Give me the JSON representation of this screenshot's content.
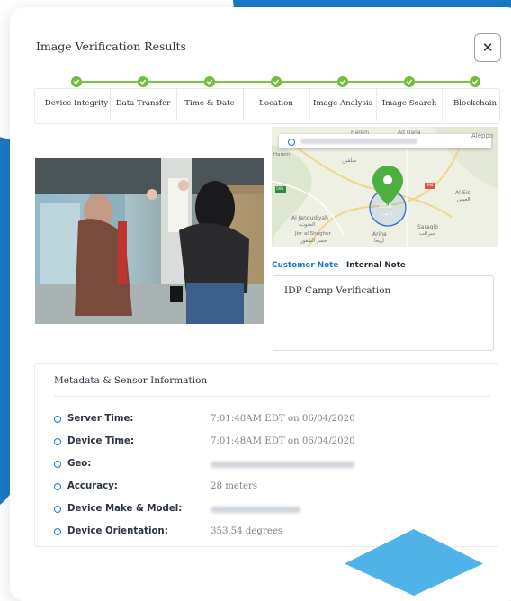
{
  "dialog": {
    "title": "Image Verification Results",
    "close_icon": "close-icon"
  },
  "steps": [
    {
      "label": "Device Integrity",
      "status": "complete"
    },
    {
      "label": "Data Transfer",
      "status": "complete"
    },
    {
      "label": "Time & Date",
      "status": "complete"
    },
    {
      "label": "Location",
      "status": "complete"
    },
    {
      "label": "Image Analysis",
      "status": "complete"
    },
    {
      "label": "Image Search",
      "status": "complete"
    },
    {
      "label": "Blockchain",
      "status": "complete"
    }
  ],
  "map": {
    "labels": {
      "harem": "Harem",
      "ad_dana": "Ad Dana",
      "aleppo": "Aleppo",
      "harem_ar": "حارم",
      "salqin": "سلقين",
      "jisr": "Jisr al Shughur",
      "jisr_ar": "جسر الشغور",
      "al_janoudiyah": "Al Janoudiyah",
      "al_janoudiyah_ar": "الجنودية",
      "idlib": "Idlib",
      "idlib_ar": "إدلب",
      "ariha": "Ariha",
      "ariha_ar": "أريحا",
      "saraqib": "Saraqib",
      "saraqib_ar": "سراقب",
      "al_eis": "Al-Eis",
      "al_eis_ar": "العيس",
      "road_591": "591",
      "road_m4": "M4",
      "hayaye": "Harem"
    }
  },
  "notes": {
    "tabs": [
      "Customer Note",
      "Internal Note"
    ],
    "active_tab": "Customer Note",
    "value": "IDP Camp Verification"
  },
  "metadata": {
    "title": "Metadata & Sensor Information",
    "rows": [
      {
        "label": "Server Time:",
        "value": "7:01:48AM EDT on 06/04/2020"
      },
      {
        "label": "Device Time:",
        "value": "7:01:48AM EDT on 06/04/2020"
      },
      {
        "label": "Geo:",
        "value": ""
      },
      {
        "label": "Accuracy:",
        "value": "28 meters"
      },
      {
        "label": "Device Make & Model:",
        "value": ""
      },
      {
        "label": "Device Orientation:",
        "value": "353.54 degrees"
      }
    ]
  },
  "colors": {
    "accent_blue": "#1a7ac6",
    "step_green": "#6fbf3d",
    "pin_green": "#4caf3f"
  }
}
